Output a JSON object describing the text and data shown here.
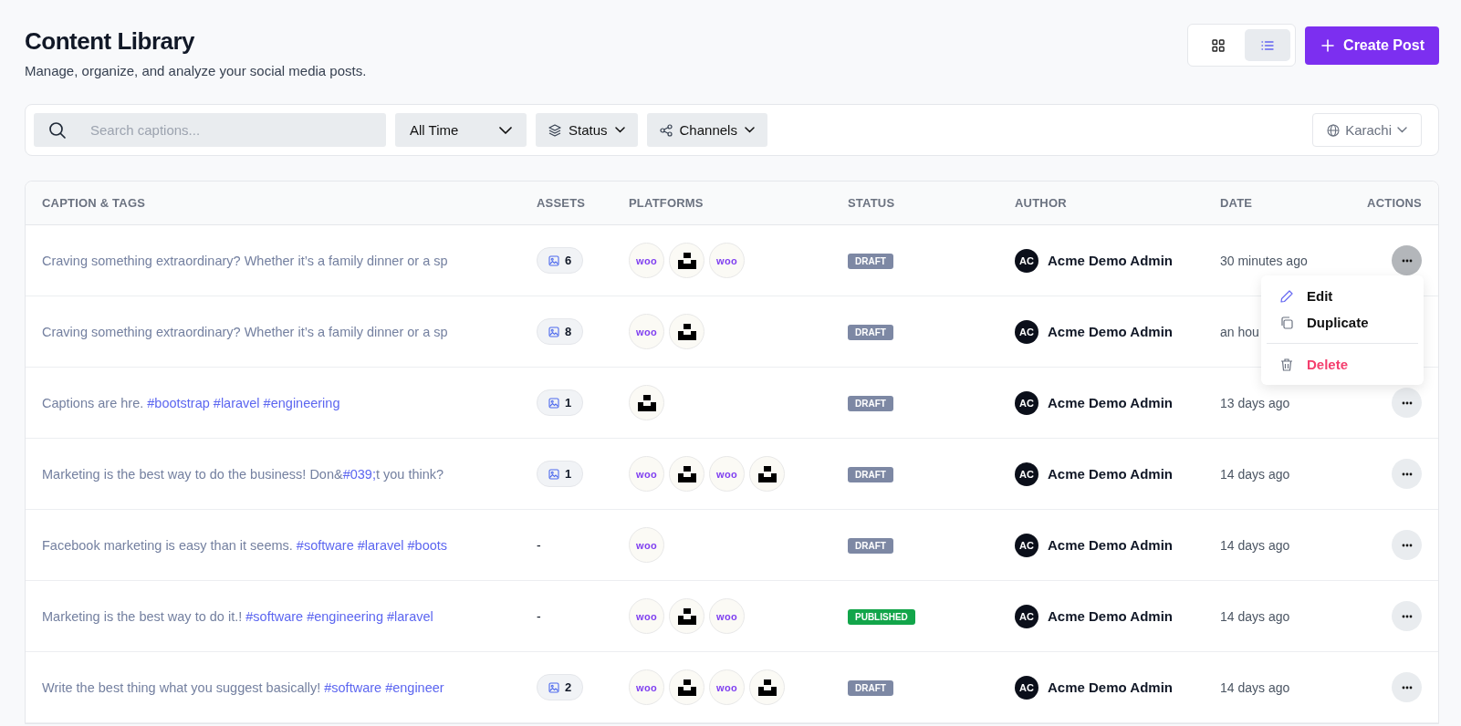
{
  "header": {
    "title": "Content Library",
    "subtitle": "Manage, organize, and analyze your social media posts.",
    "views": [
      {
        "kind": "grid",
        "selected": false
      },
      {
        "kind": "list",
        "selected": true
      }
    ],
    "create_button": "Create Post"
  },
  "filters": {
    "search": {
      "placeholder": "Search captions..."
    },
    "period": "All Time",
    "status": "Status",
    "channels": "Channels",
    "timezone": "Karachi"
  },
  "table": {
    "columns": [
      "CAPTION & TAGS",
      "ASSETS",
      "PLATFORMS",
      "STATUS",
      "AUTHOR",
      "DATE",
      "ACTIONS"
    ],
    "rows": [
      {
        "caption": [
          {
            "kind": "plain",
            "text": "Craving something extraordinary? Whether it’s a family dinner or a sp"
          }
        ],
        "assets": {
          "kind": "images",
          "text": "6"
        },
        "platforms": [
          {
            "kind": "woo",
            "label": "woo"
          },
          {
            "kind": "block"
          },
          {
            "kind": "woo",
            "label": "woo"
          }
        ],
        "status": {
          "kind": "draft",
          "label": "DRAFT"
        },
        "author": {
          "initials": "AC",
          "name": "Acme Demo Admin"
        },
        "date": "30 minutes ago",
        "actions": {
          "kind": "button",
          "open": true
        }
      },
      {
        "caption": [
          {
            "kind": "plain",
            "text": "Craving something extraordinary? Whether it’s a family dinner or a sp"
          }
        ],
        "assets": {
          "kind": "images",
          "text": "8"
        },
        "platforms": [
          {
            "kind": "woo",
            "label": "woo"
          },
          {
            "kind": "block"
          }
        ],
        "status": {
          "kind": "draft",
          "label": "DRAFT"
        },
        "author": {
          "initials": "AC",
          "name": "Acme Demo Admin"
        },
        "date": "an hou",
        "actions": {
          "kind": "covered"
        }
      },
      {
        "caption": [
          {
            "kind": "plain",
            "text": "Captions are hre. "
          },
          {
            "kind": "tag",
            "text": "#bootstrap #laravel #engineering"
          }
        ],
        "assets": {
          "kind": "images",
          "text": "1"
        },
        "platforms": [
          {
            "kind": "block"
          }
        ],
        "status": {
          "kind": "draft",
          "label": "DRAFT"
        },
        "author": {
          "initials": "AC",
          "name": "Acme Demo Admin"
        },
        "date": "13 days ago",
        "actions": {
          "kind": "button",
          "open": false
        }
      },
      {
        "caption": [
          {
            "kind": "plain",
            "text": "Marketing is the best way to do the business! Don&"
          },
          {
            "kind": "tag",
            "text": "#039;"
          },
          {
            "kind": "plain",
            "text": "t you think?"
          }
        ],
        "assets": {
          "kind": "images",
          "text": "1"
        },
        "platforms": [
          {
            "kind": "woo",
            "label": "woo"
          },
          {
            "kind": "block"
          },
          {
            "kind": "woo",
            "label": "woo"
          },
          {
            "kind": "block"
          }
        ],
        "status": {
          "kind": "draft",
          "label": "DRAFT"
        },
        "author": {
          "initials": "AC",
          "name": "Acme Demo Admin"
        },
        "date": "14 days ago",
        "actions": {
          "kind": "button",
          "open": false
        }
      },
      {
        "caption": [
          {
            "kind": "plain",
            "text": "Facebook marketing is easy than it seems. "
          },
          {
            "kind": "tag",
            "text": "#software #laravel #boots"
          }
        ],
        "assets": {
          "kind": "none",
          "text": "-"
        },
        "platforms": [
          {
            "kind": "woo",
            "label": "woo"
          }
        ],
        "status": {
          "kind": "draft",
          "label": "DRAFT"
        },
        "author": {
          "initials": "AC",
          "name": "Acme Demo Admin"
        },
        "date": "14 days ago",
        "actions": {
          "kind": "button",
          "open": false
        }
      },
      {
        "caption": [
          {
            "kind": "plain",
            "text": "Marketing is the best way to do it.! "
          },
          {
            "kind": "tag",
            "text": "#software #engineering #laravel"
          }
        ],
        "assets": {
          "kind": "none",
          "text": "-"
        },
        "platforms": [
          {
            "kind": "woo",
            "label": "woo"
          },
          {
            "kind": "block"
          },
          {
            "kind": "woo",
            "label": "woo"
          }
        ],
        "status": {
          "kind": "published",
          "label": "PUBLISHED"
        },
        "author": {
          "initials": "AC",
          "name": "Acme Demo Admin"
        },
        "date": "14 days ago",
        "actions": {
          "kind": "button",
          "open": false
        }
      },
      {
        "caption": [
          {
            "kind": "plain",
            "text": "Write the best thing what you suggest basically! "
          },
          {
            "kind": "tag",
            "text": "#software #engineer"
          }
        ],
        "assets": {
          "kind": "images",
          "text": "2"
        },
        "platforms": [
          {
            "kind": "woo",
            "label": "woo"
          },
          {
            "kind": "block"
          },
          {
            "kind": "woo",
            "label": "woo"
          },
          {
            "kind": "block"
          }
        ],
        "status": {
          "kind": "draft",
          "label": "DRAFT"
        },
        "author": {
          "initials": "AC",
          "name": "Acme Demo Admin"
        },
        "date": "14 days ago",
        "actions": {
          "kind": "button",
          "open": false
        }
      }
    ]
  },
  "action_menu": {
    "items": [
      {
        "kind": "edit",
        "label": "Edit"
      },
      {
        "kind": "duplicate",
        "label": "Duplicate"
      },
      {
        "kind": "delete",
        "label": "Delete"
      }
    ]
  }
}
